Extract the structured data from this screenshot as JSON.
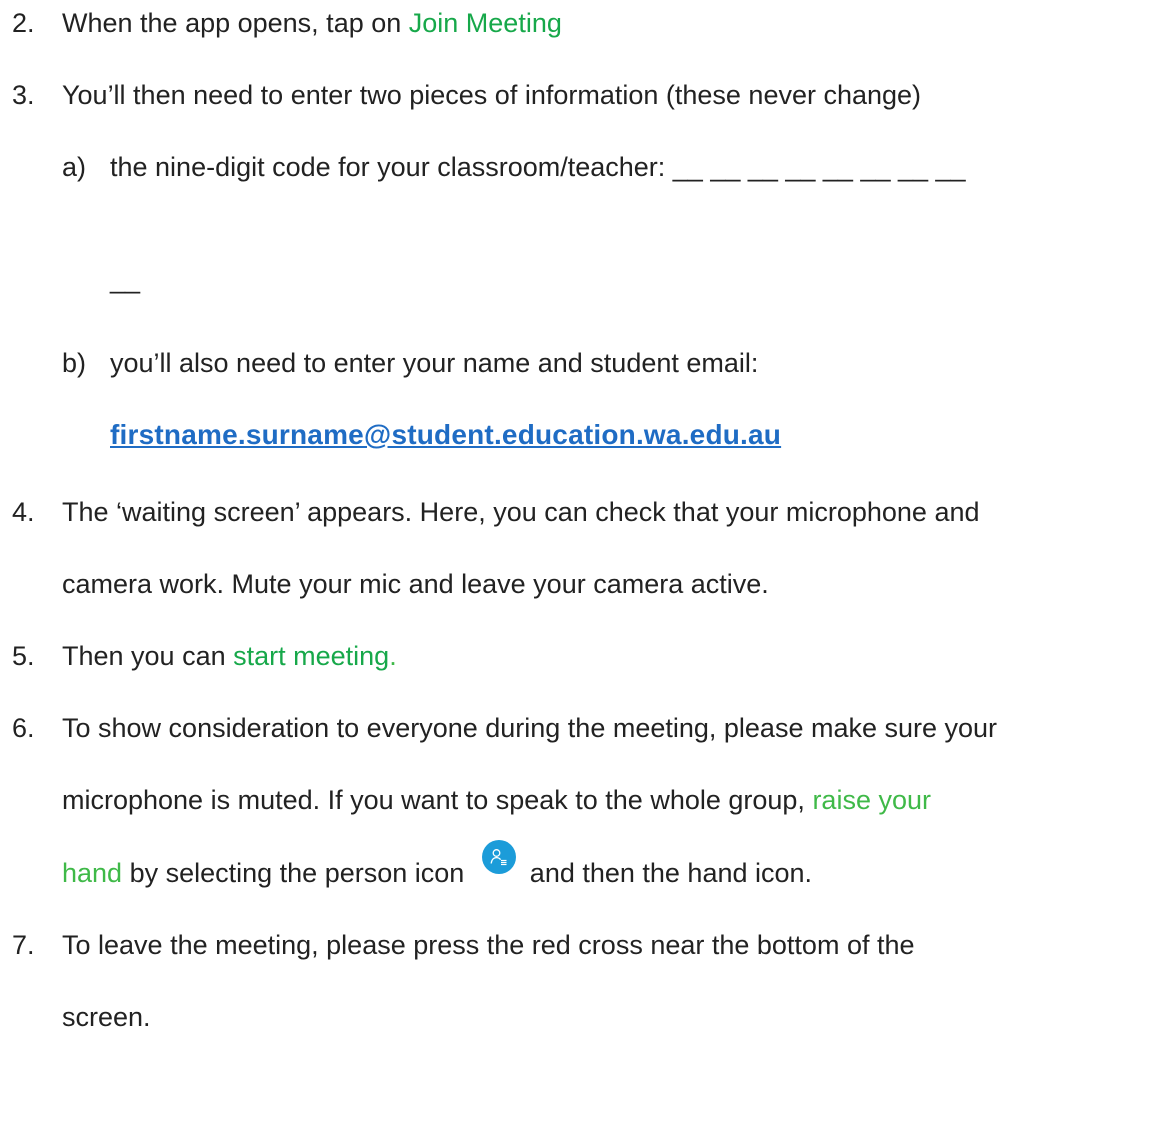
{
  "items": [
    {
      "number": "2.",
      "before": "When the app opens, tap on ",
      "highlight": "Join Meeting"
    },
    {
      "number": "3.",
      "text": "You’ll then need to enter two pieces of information (these never change)"
    },
    {
      "number": "4.",
      "line1": "The ‘waiting screen’ appears. Here, you can check that your microphone and",
      "line2": "camera work. Mute your mic and leave your camera active."
    },
    {
      "number": "5.",
      "before": "Then you can ",
      "highlight": "start meeting",
      "after": "."
    },
    {
      "number": "6.",
      "line1": "To show consideration to everyone during the meeting, please make sure your",
      "line2_before": "microphone is muted. If you want to speak to the whole group, ",
      "line2_highlight": "raise your",
      "line3_highlight": "hand",
      "line3_before_icon": " by selecting the person icon ",
      "line3_after_icon": "and then the hand icon."
    },
    {
      "number": "7.",
      "line1": "To leave the meeting, please press the red cross near the bottom of the",
      "line2": "screen."
    }
  ],
  "subitems": {
    "a": {
      "label": "a)",
      "text": "the nine-digit code for your classroom/teacher: __ __ __ __ __ __ __ __",
      "continuation": "__"
    },
    "b": {
      "label": "b)",
      "text": "you’ll also need to enter your name and student email:",
      "email": "firstname.surname@student.education.wa.edu.au"
    }
  },
  "icons": {
    "person_icon": "person-list-icon",
    "person_icon_color": "#1c9cd9"
  },
  "colors": {
    "highlight_green": "#17a84a",
    "link_blue": "#1f6cc4"
  }
}
